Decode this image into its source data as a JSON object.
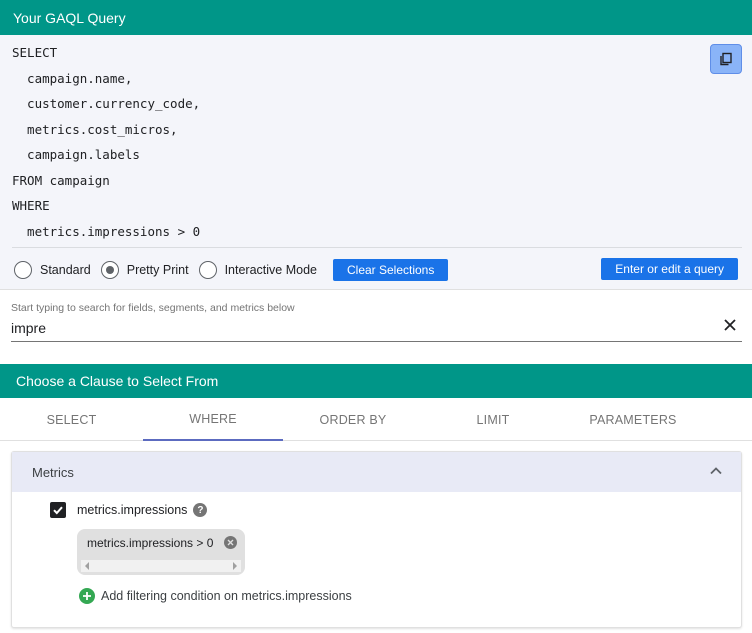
{
  "query_header": {
    "title": "Your GAQL Query"
  },
  "query": {
    "lines": [
      "SELECT",
      "  campaign.name,",
      "  customer.currency_code,",
      "  metrics.cost_micros,",
      "  campaign.labels",
      "FROM campaign",
      "WHERE",
      "  metrics.impressions > 0"
    ]
  },
  "modes": {
    "standard": "Standard",
    "pretty": "Pretty Print",
    "interactive": "Interactive Mode",
    "selected": "Pretty Print"
  },
  "buttons": {
    "clear_selections": "Clear Selections",
    "enter_query": "Enter or edit a query"
  },
  "search": {
    "hint": "Start typing to search for fields, segments, and metrics below",
    "value": "impre"
  },
  "clause_header": {
    "title": "Choose a Clause to Select From"
  },
  "tabs": [
    {
      "label": "SELECT"
    },
    {
      "label": "WHERE"
    },
    {
      "label": "ORDER BY"
    },
    {
      "label": "LIMIT"
    },
    {
      "label": "PARAMETERS"
    }
  ],
  "active_tab": "WHERE",
  "metrics_section": {
    "title": "Metrics",
    "field": "metrics.impressions",
    "checked": true,
    "condition": "metrics.impressions > 0",
    "add_condition": "Add filtering condition on metrics.impressions"
  },
  "colors": {
    "header": "#009688",
    "button_blue": "#1a73e8",
    "copy_button": "#8ab4f8",
    "metrics_header": "#e8eaf6",
    "add_green": "#34a853",
    "active_tab_underline": "#5c6bc0"
  }
}
